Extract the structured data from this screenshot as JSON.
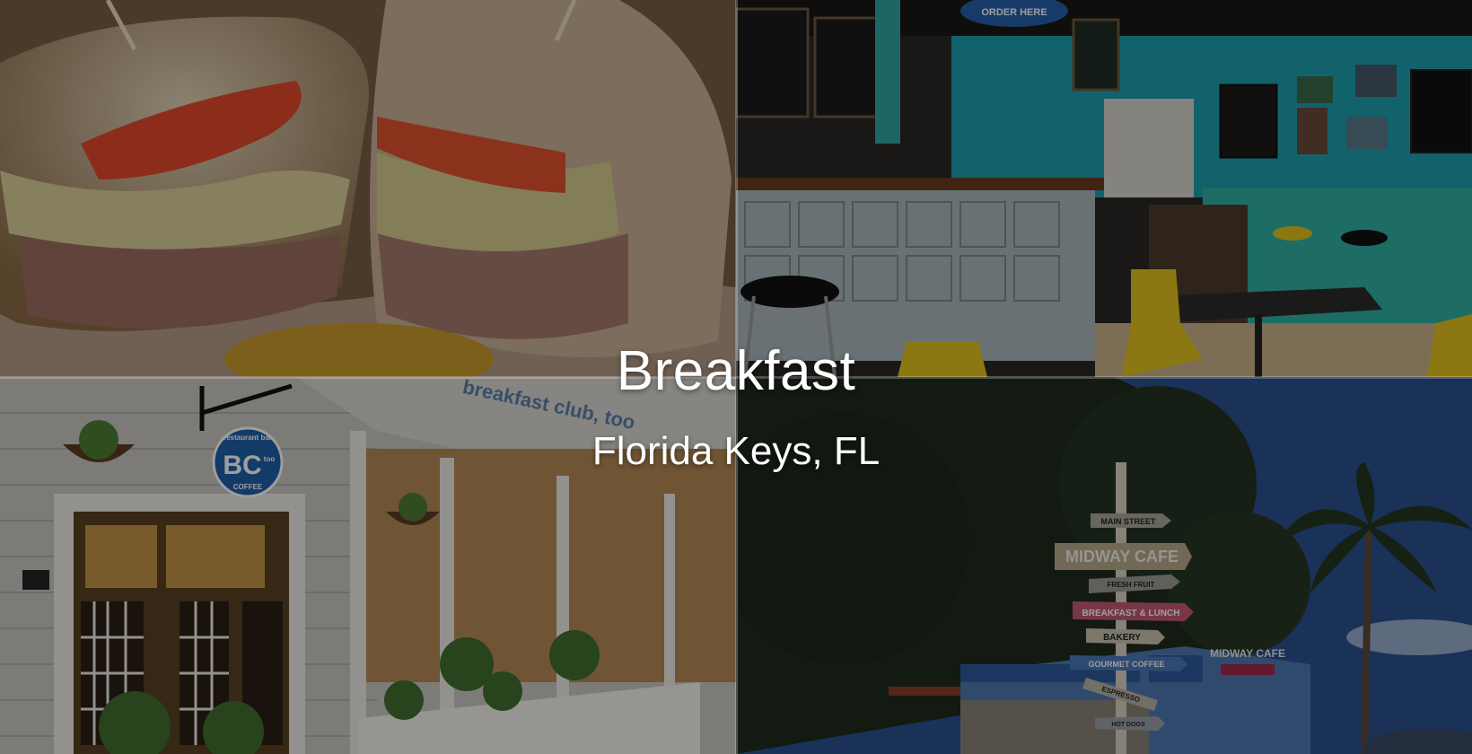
{
  "title": "Breakfast",
  "subtitle": "Florida Keys, FL",
  "photos": {
    "sandwich": {
      "label": "sandwich photo"
    },
    "interior": {
      "chalkboard_top": "ORDER HERE"
    },
    "storefront": {
      "logo_small_top": "restaurant bar",
      "logo_main": "BC",
      "logo_small_side": "too",
      "logo_bottom": "COFFEE",
      "fascia_text": "breakfast club, too"
    },
    "signpost": {
      "signs": [
        "MAIN STREET",
        "MIDWAY CAFE",
        "FRESH FRUIT",
        "BREAKFAST & LUNCH",
        "BAKERY",
        "GOURMET COFFEE",
        "ESPRESSO",
        "HOT DOGS"
      ],
      "building_sign": "MIDWAY CAFE"
    }
  },
  "colors": {
    "teal_wall": "#1e9fae",
    "sky": "#2b4f8f",
    "logo_blue": "#1f5fa8",
    "tomato": "#e24a2c"
  }
}
